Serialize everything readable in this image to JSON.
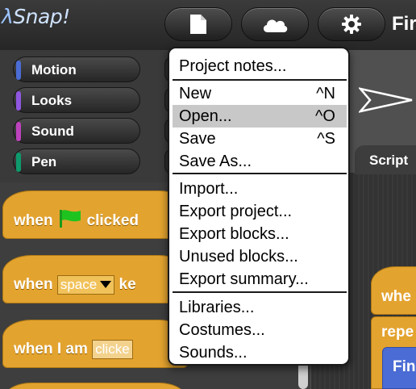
{
  "app": {
    "logo": "Snap!",
    "logo_prefix": "λ",
    "project_title": "Fir"
  },
  "colors": {
    "motion": "#4a6cd4",
    "looks": "#8f56e0",
    "sound": "#bd42bd",
    "pen": "#0e9a6c",
    "control": "#e3a32f",
    "highlight": "#c8c8c8"
  },
  "toolbar": {
    "file_icon": "file-icon",
    "cloud_icon": "cloud-icon",
    "settings_icon": "gear-icon"
  },
  "categories": [
    {
      "label": "Motion"
    },
    {
      "label": "Looks"
    },
    {
      "label": "Sound"
    },
    {
      "label": "Pen"
    }
  ],
  "palette_blocks": {
    "flag_hat": {
      "when": "when",
      "clicked": "clicked"
    },
    "key_hat": {
      "when": "when",
      "key": "space",
      "rest": "ke"
    },
    "i_am_hat": {
      "text": "when I am",
      "slot": "clicke"
    }
  },
  "scripts": {
    "tab_label": "Script",
    "hat_text": "whe",
    "repeat_text": "repe",
    "motion_text": "Fin"
  },
  "file_menu": {
    "items": [
      {
        "label": "Project notes...",
        "shortcut": ""
      },
      {
        "label": "New",
        "shortcut": "^N"
      },
      {
        "label": "Open...",
        "shortcut": "^O",
        "highlighted": true
      },
      {
        "label": "Save",
        "shortcut": "^S"
      },
      {
        "label": "Save As...",
        "shortcut": ""
      },
      {
        "label": "Import...",
        "shortcut": ""
      },
      {
        "label": "Export project...",
        "shortcut": ""
      },
      {
        "label": "Export blocks...",
        "shortcut": ""
      },
      {
        "label": "Unused blocks...",
        "shortcut": ""
      },
      {
        "label": "Export summary...",
        "shortcut": ""
      },
      {
        "label": "Libraries...",
        "shortcut": ""
      },
      {
        "label": "Costumes...",
        "shortcut": ""
      },
      {
        "label": "Sounds...",
        "shortcut": ""
      }
    ]
  }
}
